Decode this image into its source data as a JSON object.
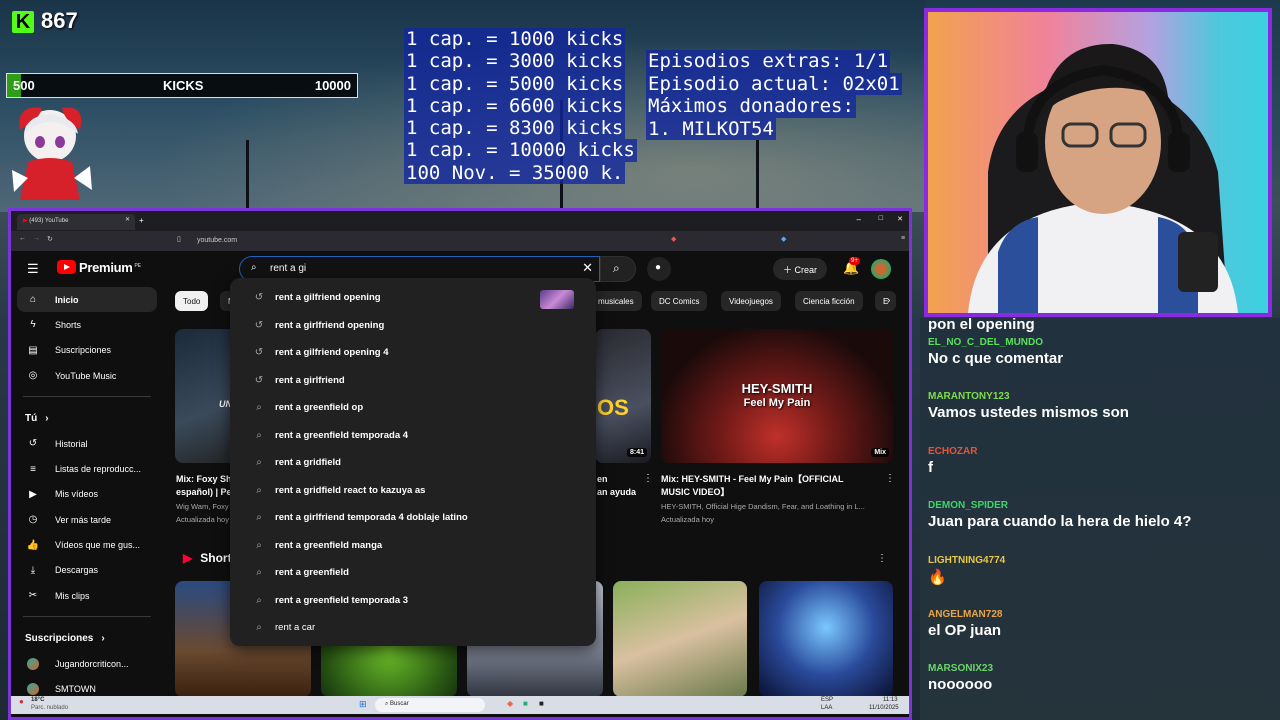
{
  "overlay": {
    "kick_icon": "K",
    "kick_count": "867",
    "bar": {
      "min": "500",
      "label": "KICKS",
      "max": "10000",
      "progress": 0.04
    },
    "rules": [
      "1 cap. = 1000 kicks",
      "1 cap. = 3000 kicks",
      "1 cap. = 5000 kicks",
      "1 cap. = 6600 kicks",
      "1 cap. = 8300 kicks",
      "1 cap. = 10000 kicks",
      "100 Nov. = 35000 k."
    ],
    "info": [
      "Episodios extras: 1/1",
      "Episodio actual: 02x01",
      "Máximos donadores:",
      "1. MILKOT54"
    ]
  },
  "browser": {
    "tab_title": "(493) YouTube",
    "url": "youtube.com"
  },
  "youtube": {
    "logo": "Premium",
    "logo_region": "PE",
    "search_value": "rent a gi",
    "create_label": "Crear",
    "notif_count": "9+",
    "sidebar": {
      "main": [
        {
          "icon": "home-icon",
          "label": "Inicio"
        },
        {
          "icon": "shorts-icon",
          "label": "Shorts"
        },
        {
          "icon": "subscriptions-icon",
          "label": "Suscripciones"
        },
        {
          "icon": "music-icon",
          "label": "YouTube Music"
        }
      ],
      "you_header": "Tú",
      "you": [
        {
          "icon": "history-icon",
          "label": "Historial"
        },
        {
          "icon": "playlist-icon",
          "label": "Listas de reproducc..."
        },
        {
          "icon": "my-videos-icon",
          "label": "Mis vídeos"
        },
        {
          "icon": "watch-later-icon",
          "label": "Ver más tarde"
        },
        {
          "icon": "liked-icon",
          "label": "Vídeos que me gus..."
        },
        {
          "icon": "download-icon",
          "label": "Descargas"
        },
        {
          "icon": "clips-icon",
          "label": "Mis clips"
        }
      ],
      "subs_header": "Suscripciones",
      "subs": [
        {
          "label": "Jugandorcriticon..."
        },
        {
          "label": "SMTOWN"
        }
      ]
    },
    "chips": [
      "Todo",
      "Mú",
      "musicales",
      "DC Comics",
      "Videojuegos",
      "Ciencia ficción",
      "E"
    ],
    "suggestions": [
      {
        "kind": "history",
        "text": "rent a gilfriend opening"
      },
      {
        "kind": "history",
        "text": "rent a girlfriend opening"
      },
      {
        "kind": "history",
        "text": "rent a gilfriend opening 4"
      },
      {
        "kind": "history",
        "text": "rent a girlfriend"
      },
      {
        "kind": "search",
        "text": "rent a greenfield op"
      },
      {
        "kind": "search",
        "text": "rent a greenfield temporada 4"
      },
      {
        "kind": "search",
        "text": "rent a gridfield"
      },
      {
        "kind": "search",
        "text": "rent a gridfield react to kazuya as"
      },
      {
        "kind": "search",
        "text": "rent a girlfriend temporada 4 doblaje latino"
      },
      {
        "kind": "search",
        "text": "rent a greenfield manga"
      },
      {
        "kind": "search",
        "text": "rent a greenfield"
      },
      {
        "kind": "search",
        "text": "rent a greenfield temporada 3"
      },
      {
        "kind": "plain",
        "text": "rent a car"
      }
    ],
    "videos": [
      {
        "title_line1": "Mix: Foxy Sha",
        "title_line2": "español) | Pea",
        "meta1": "Wig Wam, Foxy S",
        "meta2": "Actualizada hoy",
        "thumb_text": "UN"
      },
      {
        "title_line1": "en",
        "title_line2": "an ayuda",
        "duration": "8:41",
        "thumb_text": "OS"
      },
      {
        "title_line1": "Mix: HEY-SMITH - Feel My Pain【OFFICIAL",
        "title_line2": "MUSIC VIDEO】",
        "meta1": "HEY-SMITH, Official Hige Dandism, Fear, and Loathing in L...",
        "meta2": "Actualizada hoy",
        "badge": "Mix",
        "thumb_line1": "HEY-SMITH",
        "thumb_line2": "Feel My Pain"
      }
    ],
    "shorts_label": "Shorts"
  },
  "chat": {
    "top_fragment": "pon el opening",
    "messages": [
      {
        "user": "EL_NO_C_DEL_MUNDO",
        "color": "#5be05b",
        "text": "No c que comentar"
      },
      {
        "user": "MARANTONY123",
        "color": "#7fdc4a",
        "text": "Vamos ustedes mismos son"
      },
      {
        "user": "ECHOZAR",
        "color": "#e5533a",
        "text": "f"
      },
      {
        "user": "DEMON_SPIDER",
        "color": "#3fd46a",
        "text": "Juan para cuando la hera de hielo 4?"
      },
      {
        "user": "LIGHTNING4774",
        "color": "#e7c84b",
        "text": "🔥"
      },
      {
        "user": "ANGELMAN728",
        "color": "#e9a646",
        "text": "el OP juan"
      },
      {
        "user": "MARSONIX23",
        "color": "#6ad66a",
        "text": "noooooo"
      }
    ]
  },
  "taskbar": {
    "weather_temp": "18°C",
    "weather_desc": "Parc. nublado",
    "search": "Buscar",
    "lang1": "ESP",
    "lang2": "LAA",
    "time": "11:13",
    "date": "11/10/2025"
  }
}
